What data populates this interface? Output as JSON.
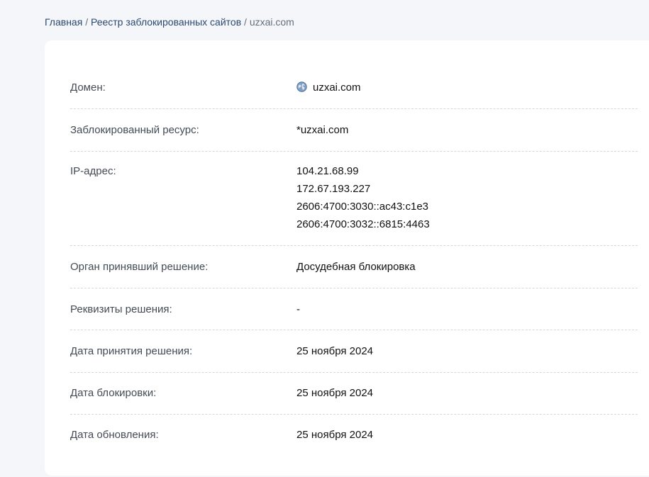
{
  "breadcrumb": {
    "home": "Главная",
    "separator": "/",
    "registry": "Реестр заблокированных сайтов",
    "current": "uzxai.com"
  },
  "details": {
    "domain": {
      "label": "Домен:",
      "value": "uzxai.com",
      "icon": "globe-icon"
    },
    "blocked_resource": {
      "label": "Заблокированный ресурс:",
      "value": "*uzxai.com"
    },
    "ip": {
      "label": "IP-адрес:",
      "values": [
        "104.21.68.99",
        "172.67.193.227",
        "2606:4700:3030::ac43:c1e3",
        "2606:4700:3032::6815:4463"
      ]
    },
    "authority": {
      "label": "Орган принявший решение:",
      "value": "Досудебная блокировка"
    },
    "decision_details": {
      "label": "Реквизиты решения:",
      "value": "-"
    },
    "decision_date": {
      "label": "Дата принятия решения:",
      "value": "25 ноября 2024"
    },
    "block_date": {
      "label": "Дата блокировки:",
      "value": "25 ноября 2024"
    },
    "update_date": {
      "label": "Дата обновления:",
      "value": "25 ноября 2024"
    }
  },
  "colors": {
    "page_background": "#f4f6f9",
    "card_background": "#ffffff",
    "link": "#2b4a6f",
    "label": "#444b55",
    "value": "#111111",
    "divider": "#d4d8dd"
  }
}
